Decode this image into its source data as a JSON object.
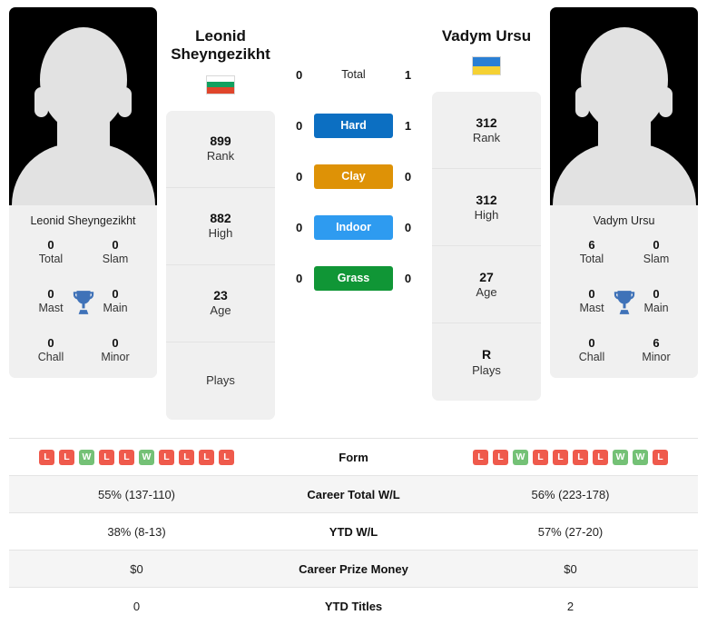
{
  "players": {
    "left": {
      "name": "Leonid Sheyngezikht",
      "display_name_line1": "Leonid",
      "display_name_line2": "Sheyngezikht",
      "caption": "Leonid Sheyngezikht",
      "flag": "bulgaria",
      "flag_colors": [
        "#ffffff",
        "#12a05f",
        "#e0452b"
      ],
      "trophies": [
        {
          "value": "0",
          "label": "Total"
        },
        {
          "value": "0",
          "label": "Slam"
        },
        {
          "value": "0",
          "label": "Mast"
        },
        {
          "value": "0",
          "label": "Main"
        },
        {
          "value": "0",
          "label": "Chall"
        },
        {
          "value": "0",
          "label": "Minor"
        }
      ],
      "details": [
        {
          "value": "899",
          "label": "Rank"
        },
        {
          "value": "882",
          "label": "High"
        },
        {
          "value": "23",
          "label": "Age"
        },
        {
          "value": "",
          "label": "Plays"
        }
      ]
    },
    "right": {
      "name": "Vadym Ursu",
      "display_name_line1": "Vadym Ursu",
      "display_name_line2": "",
      "caption": "Vadym Ursu",
      "flag": "ukraine",
      "flag_colors": [
        "#2a7fd4",
        "#f5d133"
      ],
      "trophies": [
        {
          "value": "6",
          "label": "Total"
        },
        {
          "value": "0",
          "label": "Slam"
        },
        {
          "value": "0",
          "label": "Mast"
        },
        {
          "value": "0",
          "label": "Main"
        },
        {
          "value": "0",
          "label": "Chall"
        },
        {
          "value": "6",
          "label": "Minor"
        }
      ],
      "details": [
        {
          "value": "312",
          "label": "Rank"
        },
        {
          "value": "312",
          "label": "High"
        },
        {
          "value": "27",
          "label": "Age"
        },
        {
          "value": "R",
          "label": "Plays"
        }
      ]
    }
  },
  "head_to_head": [
    {
      "label": "Total",
      "left": "0",
      "right": "1",
      "color": ""
    },
    {
      "label": "Hard",
      "left": "0",
      "right": "1",
      "color": "#0c6fc2"
    },
    {
      "label": "Clay",
      "left": "0",
      "right": "0",
      "color": "#de9206"
    },
    {
      "label": "Indoor",
      "left": "0",
      "right": "0",
      "color": "#2e9bf0"
    },
    {
      "label": "Grass",
      "left": "0",
      "right": "0",
      "color": "#109636"
    }
  ],
  "form": {
    "label": "Form",
    "left": [
      "L",
      "L",
      "W",
      "L",
      "L",
      "W",
      "L",
      "L",
      "L",
      "L"
    ],
    "right": [
      "L",
      "L",
      "W",
      "L",
      "L",
      "L",
      "L",
      "W",
      "W",
      "L"
    ],
    "win_color": "#74c176",
    "loss_color": "#ef5a4c"
  },
  "stats_rows": [
    {
      "label": "Career Total W/L",
      "left": "55% (137-110)",
      "right": "56% (223-178)"
    },
    {
      "label": "YTD W/L",
      "left": "38% (8-13)",
      "right": "57% (27-20)"
    },
    {
      "label": "Career Prize Money",
      "left": "$0",
      "right": "$0"
    },
    {
      "label": "YTD Titles",
      "left": "0",
      "right": "2"
    }
  ],
  "icons": {
    "trophy": "trophy-icon"
  }
}
